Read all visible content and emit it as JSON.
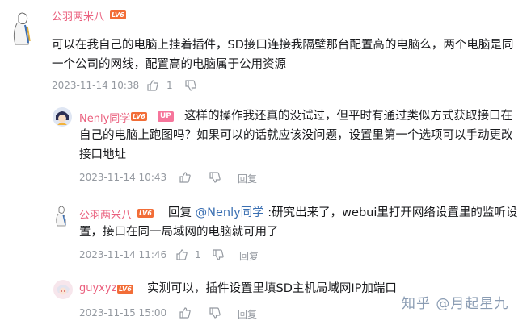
{
  "comments": [
    {
      "user": "公羽两米八",
      "level": "LV6",
      "text": "可以在我自己的电脑上挂着插件，SD接口连接我隔壁那台配置高的电脑么，两个电脑是同一个公司的网线，配置高的电脑属于公用资源",
      "time": "2023-11-14 10:38",
      "likes": "1"
    },
    {
      "user": "Nenly同学",
      "level": "LV6",
      "badge": "UP",
      "text": "这样的操作我还真的没试过，但平时有通过类似方式获取接口在自己的电脑上跑图吗？如果可以的话就应该没问题，设置里第一个选项可以手动更改接口地址",
      "time": "2023-11-14 10:43",
      "reply_label": "回复"
    },
    {
      "user": "公羽两米八",
      "level": "LV6",
      "reply_prefix": "回复 ",
      "reply_to": "@Nenly同学",
      "text": " :研究出来了，webui里打开网络设置里的监听设置，接口在同一局域网的电脑就可用了",
      "time": "2023-11-14 11:46",
      "likes": "1",
      "reply_label": "回复"
    },
    {
      "user": "guyxyz",
      "level": "LV6",
      "text": "实测可以，插件设置里填SD主机局域网IP加端口",
      "time": "2023-11-15 15:00",
      "reply_label": "回复"
    }
  ],
  "watermark": "知乎 @月起星九",
  "colors": {
    "username": "#ea5f7d",
    "level_badge": "#f26d37",
    "up_badge": "#f6759b",
    "meta": "#9499a0",
    "link": "#3a6fb2"
  },
  "icons": [
    "thumbs-up-icon",
    "thumbs-down-icon"
  ]
}
